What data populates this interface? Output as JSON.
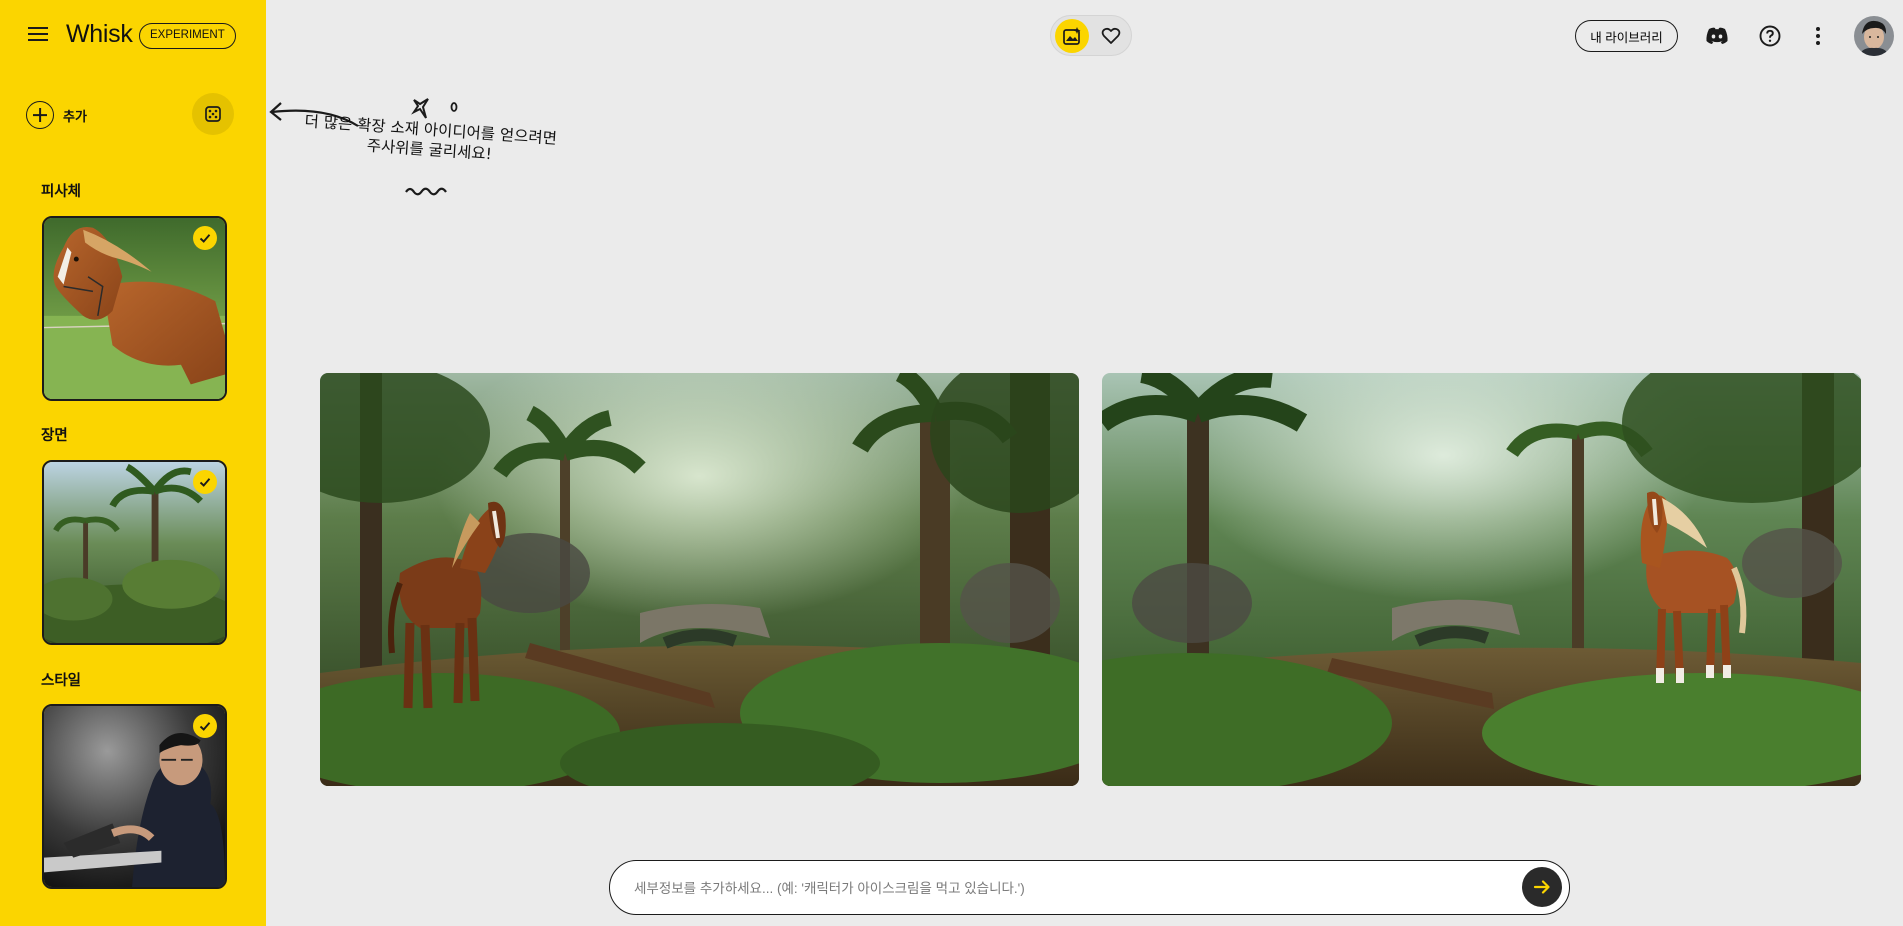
{
  "app": {
    "brand": "Whisk",
    "badge": "EXPERIMENT"
  },
  "sidebar": {
    "add_label": "추가",
    "sections": [
      {
        "label": "피사체"
      },
      {
        "label": "장면"
      },
      {
        "label": "스타일"
      }
    ]
  },
  "header": {
    "library_label": "내 라이브러리"
  },
  "hint": {
    "line1": "더 많은 확장 소재 아이디어를 얻으려면",
    "line2": "주사위를 굴리세요!"
  },
  "prompt": {
    "placeholder": "세부정보를 추가하세요... (예: '캐릭터가 아이스크림을 먹고 있습니다.')"
  },
  "colors": {
    "accent": "#fbd500",
    "dark": "#1b1b1b",
    "canvas": "#ebebeb"
  }
}
